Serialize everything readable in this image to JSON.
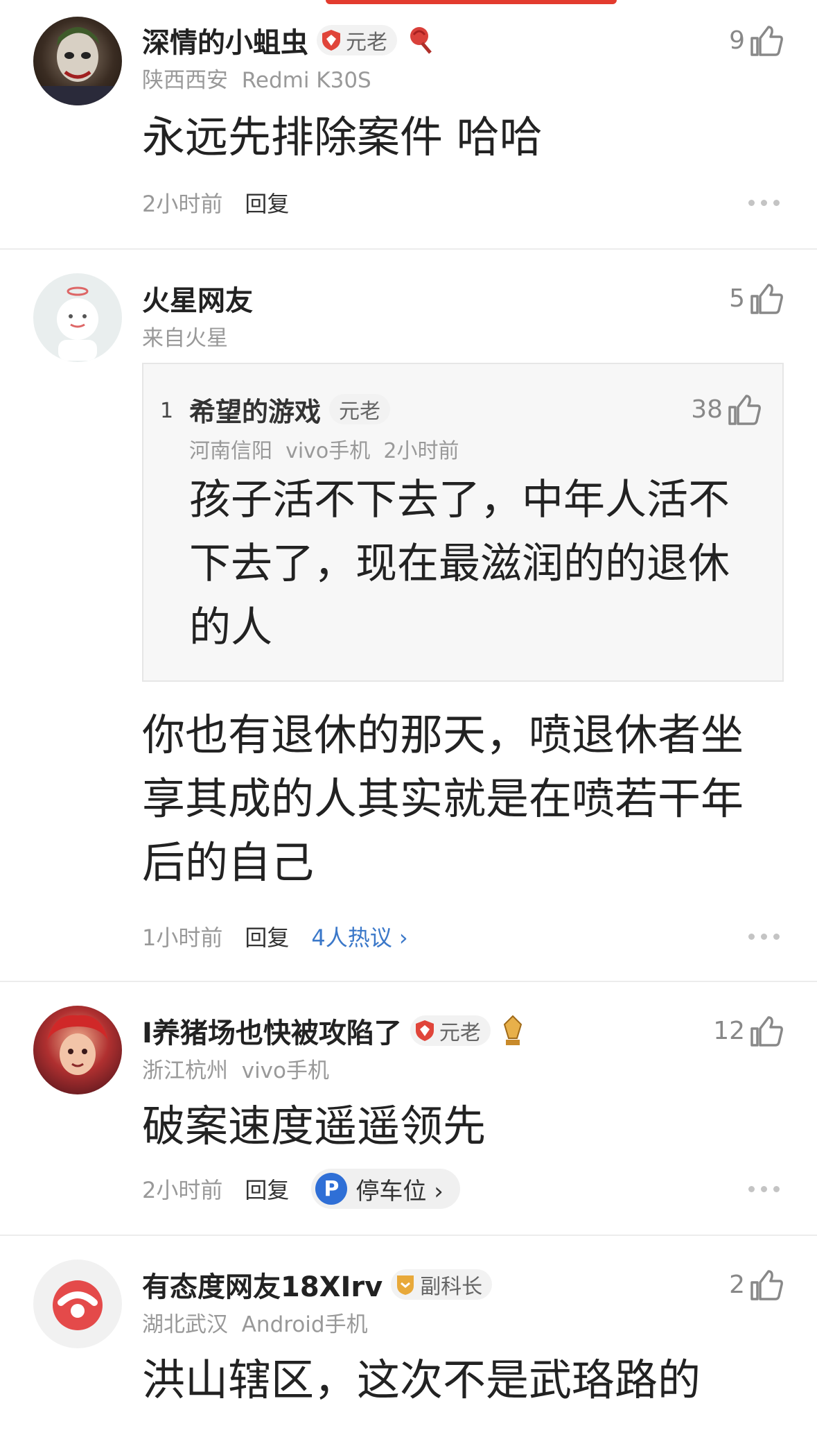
{
  "comments": [
    {
      "name": "深情的小蛆虫",
      "badge": "元老",
      "location": "陕西西安",
      "device": "Redmi K30S",
      "likes": "9",
      "text": "永远先排除案件 哈哈",
      "time": "2小时前",
      "reply": "回复"
    },
    {
      "name": "火星网友",
      "location": "来自火星",
      "likes": "5",
      "quote": {
        "index": "1",
        "name": "希望的游戏",
        "badge": "元老",
        "location": "河南信阳",
        "device": "vivo手机",
        "time": "2小时前",
        "likes": "38",
        "text": "孩子活不下去了，中年人活不下去了，现在最滋润的的退休的人"
      },
      "text": "你也有退休的那天，喷退休者坐享其成的人其实就是在喷若干年后的自己",
      "time": "1小时前",
      "reply": "回复",
      "hot": "4人热议 ›"
    },
    {
      "name": "I养猪场也快被攻陷了",
      "badge": "元老",
      "location": "浙江杭州",
      "device": "vivo手机",
      "likes": "12",
      "text": "破案速度遥遥领先",
      "time": "2小时前",
      "reply": "回复",
      "tag_icon": "P",
      "tag": "停车位 ›"
    },
    {
      "name": "有态度网友18XIrv",
      "badge": "副科长",
      "location": "湖北武汉",
      "device": "Android手机",
      "likes": "2",
      "text": "洪山辖区，这次不是武珞路的"
    }
  ],
  "colors": {
    "accent_blue": "#3b78c9",
    "badge_red": "#e0453a",
    "badge_gold": "#e8a93a"
  }
}
